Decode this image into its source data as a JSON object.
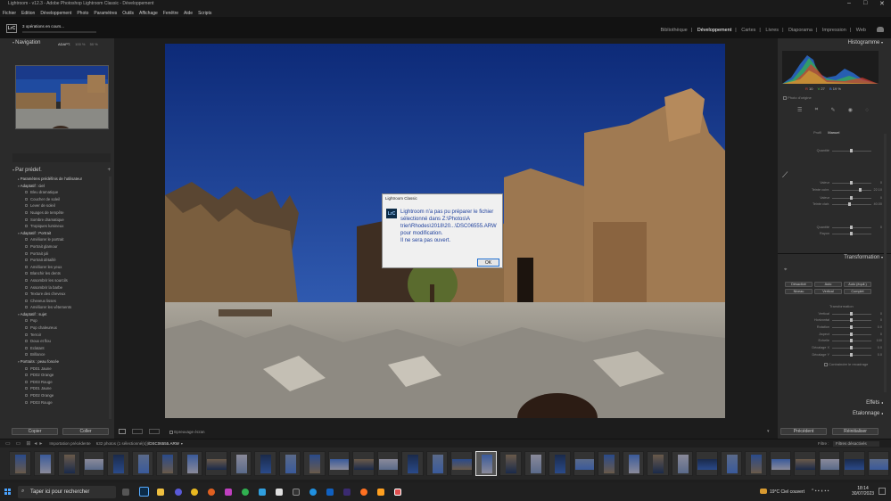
{
  "window": {
    "title": "Lightroom - v12.3 - Adobe Photoshop Lightroom Classic - Développement"
  },
  "menu": [
    "Fichier",
    "Edition",
    "Développement",
    "Photo",
    "Paramètres",
    "Outils",
    "Affichage",
    "Fenêtre",
    "Aide",
    "Scripts"
  ],
  "identity": {
    "logo": "LrC",
    "operations": "3 opérations en cours..."
  },
  "modules": [
    "Bibliothèque",
    "Développement",
    "Cartes",
    "Livres",
    "Diaporama",
    "Impression",
    "Web"
  ],
  "active_module": "Développement",
  "navigator": {
    "title": "Navigation",
    "zoom_options": [
      "ADAPT.",
      "100 %",
      "50 %"
    ]
  },
  "presets": {
    "title": "Par prédef.",
    "groups": [
      {
        "name": "Paramètres prédéfinis de l'utilisateur",
        "items": []
      },
      {
        "name": "Adaptatif : ciel",
        "items": [
          "Bleu dramatique",
          "Coucher de soleil",
          "Lever de soleil",
          "Nuages de tempête",
          "Sombre dramatique",
          "Tropiques lumineux"
        ]
      },
      {
        "name": "Adaptatif : Portrait",
        "items": [
          "Améliorer le portrait",
          "Portrait glamour",
          "Portrait joli",
          "Portrait détaillé",
          "Améliorer les yeux",
          "Blanchir les dents",
          "Assombrir les sourcils",
          "Assombrir la barbe",
          "Texture des cheveux",
          "Cheveux lisses",
          "Améliorer les vêtements"
        ]
      },
      {
        "name": "Adaptatif : sujet",
        "items": [
          "Pop",
          "Pop chaleureux",
          "Terroir",
          "Doux et flou",
          "Eclatant",
          "Brillance"
        ]
      },
      {
        "name": "Portraits : peau foncée",
        "items": [
          "PD01 Jaune",
          "PD02 Orange",
          "PD03 Rouge",
          "PD01 Jaune",
          "PD02 Orange",
          "PD03 Rouge"
        ]
      }
    ]
  },
  "left_buttons": {
    "copy": "Copier",
    "paste": "Coller"
  },
  "toolbar": {
    "softproof": "Epreuvage écran"
  },
  "histogram": {
    "title": "Histogramme",
    "readout": [
      "10",
      "27",
      "19 %"
    ],
    "original_photo": "Photo d'origine"
  },
  "right_sections": {
    "profile": "Profil",
    "manual": "Manuel",
    "transform": "Transformation",
    "effects": "Effets",
    "calibration": "Etalonnage"
  },
  "sliders_top": [
    {
      "label": "Quantité",
      "value": ""
    },
    {
      "label": "Valeur",
      "value": "0"
    },
    {
      "label": "Teinte cuivr.",
      "value": "22.10"
    },
    {
      "label": "Valeur",
      "value": "0"
    },
    {
      "label": "Teinte clair.",
      "value": "40.00"
    },
    {
      "label": "Quantité",
      "value": "0"
    },
    {
      "label": "Rayon",
      "value": ""
    }
  ],
  "transform": {
    "upright_buttons": [
      "Désactivé",
      "Auto",
      "Auto (équil.)",
      "Niveau",
      "Vertical",
      "Complet"
    ],
    "section_label": "Transformation",
    "sliders": [
      {
        "label": "Vertical",
        "value": "0"
      },
      {
        "label": "Horizontal",
        "value": "0"
      },
      {
        "label": "Rotation",
        "value": "0.0"
      },
      {
        "label": "Aspect",
        "value": "0"
      },
      {
        "label": "Echelle",
        "value": "100"
      },
      {
        "label": "Décalage X",
        "value": "0.0"
      },
      {
        "label": "Décalage Y",
        "value": "0.0"
      }
    ],
    "constrain": "Contraindre le recadrage"
  },
  "right_buttons": {
    "previous": "Précédent",
    "reset": "Réinitialiser"
  },
  "filmstrip": {
    "source": "Importation précédente",
    "count": "632 photos (1 sélectionné(s))",
    "filename": "/DSC06555.ARW",
    "filter_label": "Filtre :",
    "filter_value": "Filtres désactivés"
  },
  "dialog": {
    "title": "Lightroom Classic",
    "icon": "LrC",
    "message": [
      "Lightroom n'a pas pu préparer le fichier",
      "sélectionné dans Z:\\Photos\\A",
      "trier\\Rhodes\\2018\\20...\\DSC06555.ARW",
      "pour modification.",
      "Il ne sera pas ouvert."
    ],
    "ok": "OK"
  },
  "taskbar": {
    "search": "Taper ici pour rechercher",
    "weather": "19°C Ciel couvert",
    "time": "18:14",
    "date": "30/07/2023"
  },
  "colors": {
    "panel": "#2b2b2b",
    "center": "#1c1c1c",
    "dialog_text": "#1d3f9c",
    "taskbar": "#202020"
  }
}
